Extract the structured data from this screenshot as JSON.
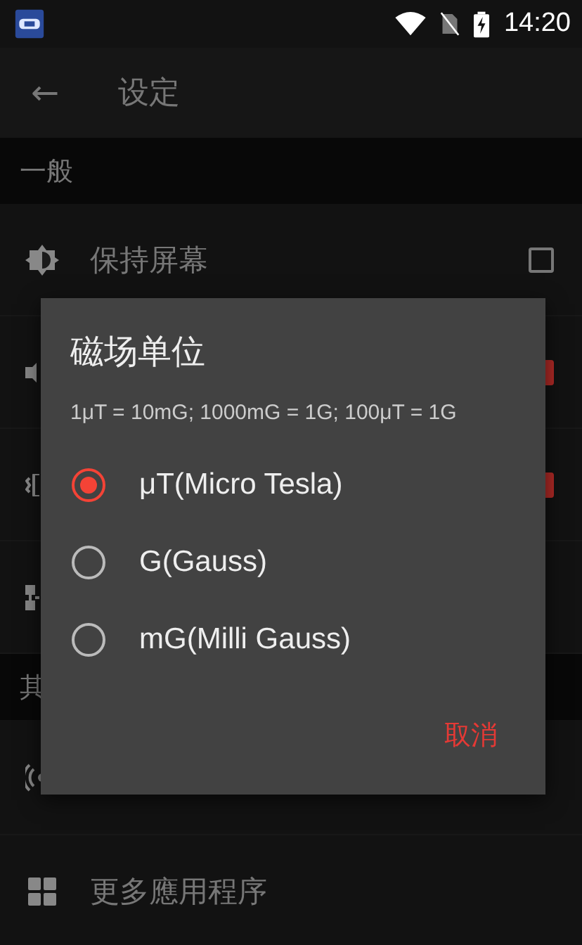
{
  "status_bar": {
    "time": "14:20"
  },
  "toolbar": {
    "back": "←",
    "title": "设定"
  },
  "sections": [
    {
      "header": "一般",
      "rows": [
        {
          "kind": "checkbox",
          "label": "保持屏幕",
          "checked": false
        },
        {
          "kind": "checkbox",
          "checked": true
        },
        {
          "kind": "checkbox",
          "checked": true
        },
        {
          "kind": "plain"
        }
      ]
    },
    {
      "header": "其",
      "rows": [
        {
          "kind": "plain"
        },
        {
          "kind": "plain",
          "label": "更多應用程序"
        }
      ]
    }
  ],
  "dialog": {
    "title": "磁场单位",
    "message": "1μT = 10mG; 1000mG = 1G; 100μT = 1G",
    "options": [
      {
        "label": "μT(Micro Tesla)",
        "selected": true
      },
      {
        "label": "G(Gauss)",
        "selected": false
      },
      {
        "label": "mG(Milli Gauss)",
        "selected": false
      }
    ],
    "cancel": "取消"
  }
}
